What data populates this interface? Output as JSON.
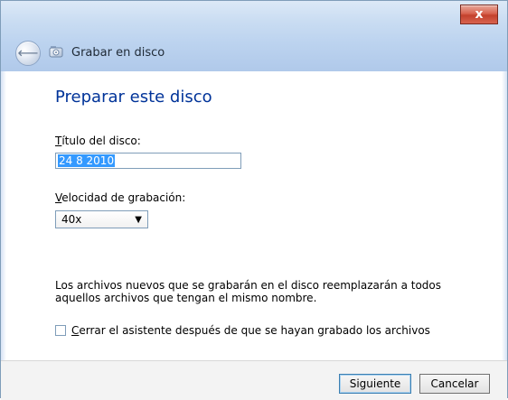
{
  "window": {
    "title": "Grabar en disco",
    "close_glyph": "x"
  },
  "icons": {
    "back": "back-arrow-icon",
    "disc": "disc-icon",
    "dropdown": "chevron-down-icon"
  },
  "main": {
    "heading": "Preparar este disco",
    "disc_title": {
      "label_prefix": "T",
      "label_rest": "ítulo del disco:",
      "value": "24 8 2010"
    },
    "speed": {
      "label_prefix": "V",
      "label_rest": "elocidad de grabación:",
      "selected": "40x"
    },
    "note": "Los archivos nuevos que se grabarán en el disco reemplazarán a todos aquellos archivos que tengan el mismo nombre.",
    "close_wizard": {
      "label_prefix": "C",
      "label_rest": "errar el asistente después de que se hayan grabado los archivos",
      "checked": false
    }
  },
  "footer": {
    "next_label": "Siguiente",
    "cancel_label": "Cancelar"
  }
}
